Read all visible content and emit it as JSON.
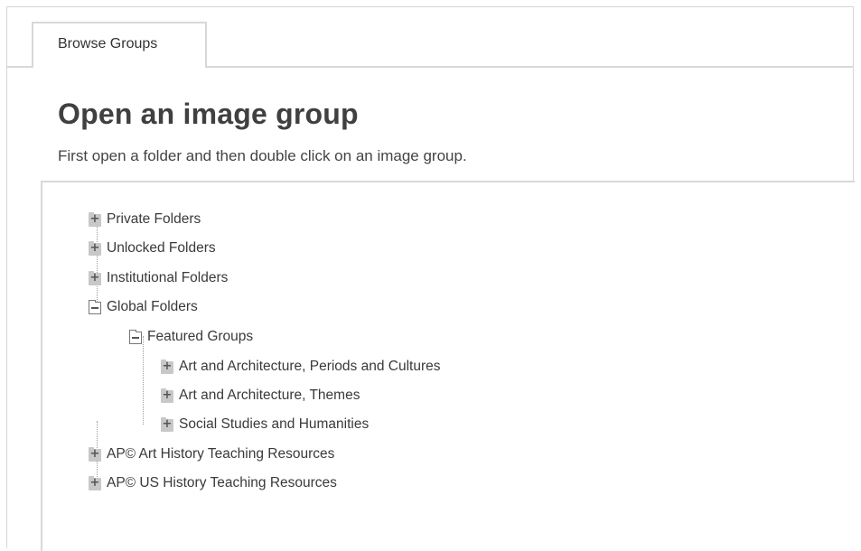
{
  "tabs": [
    {
      "label": "Browse Groups",
      "active": true
    }
  ],
  "header": {
    "title": "Open an image group",
    "instructions": "First open a folder and then double click on an image group."
  },
  "tree": {
    "nodes": [
      {
        "label": "Private Folders",
        "state": "collapsed",
        "level": 0
      },
      {
        "label": "Unlocked Folders",
        "state": "collapsed",
        "level": 0
      },
      {
        "label": "Institutional Folders",
        "state": "collapsed",
        "level": 0
      },
      {
        "label": "Global Folders",
        "state": "expanded",
        "level": 0
      },
      {
        "label": "Featured Groups",
        "state": "expanded",
        "level": 1
      },
      {
        "label": "Art and Architecture, Periods and Cultures",
        "state": "collapsed",
        "level": 2
      },
      {
        "label": "Art and Architecture, Themes",
        "state": "collapsed",
        "level": 2
      },
      {
        "label": "Social Studies and Humanities",
        "state": "collapsed",
        "level": 2
      },
      {
        "label": "AP© Art History Teaching Resources",
        "state": "collapsed",
        "level": 0
      },
      {
        "label": "AP© US History Teaching Resources",
        "state": "collapsed",
        "level": 0
      }
    ]
  },
  "icons": {
    "collapsed": "folder-plus-icon",
    "expanded": "folder-minus-icon"
  },
  "colors": {
    "border": "#d8d8d8",
    "text": "#333333",
    "folder_collapsed": "#c8c8c8"
  }
}
